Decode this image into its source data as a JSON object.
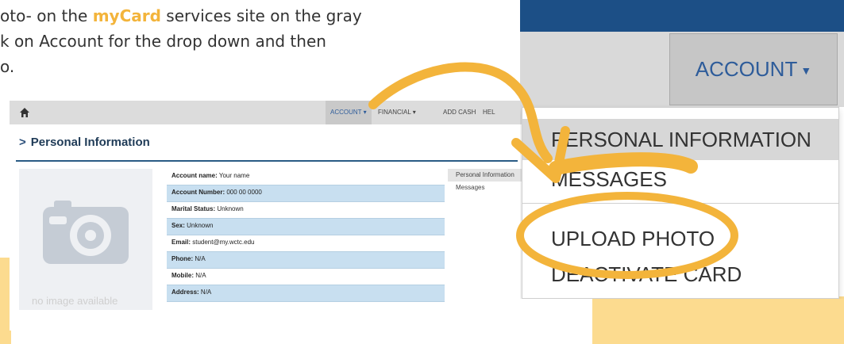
{
  "instructions": {
    "line1_before": "oto- on the ",
    "line1_brand": "myCard",
    "line1_after": " services site on the gray",
    "line2": "k on Account for the drop down and then",
    "line3": "o."
  },
  "portal": {
    "nav": {
      "home_icon": "home-icon",
      "items": [
        "ACCOUNT ▾",
        "FINANCIAL ▾",
        "ADD CASH",
        "HEL"
      ]
    },
    "page_title": "Personal Information",
    "no_image": "no image available",
    "info_rows": [
      {
        "label": "Account name:",
        "value": " Your name"
      },
      {
        "label": "Account Number:",
        "value": " 000 00 0000"
      },
      {
        "label": "Marital Status:",
        "value": " Unknown"
      },
      {
        "label": "Sex:",
        "value": " Unknown"
      },
      {
        "label": "Email:",
        "value": " student@my.wctc.edu"
      },
      {
        "label": "Phone:",
        "value": " N/A"
      },
      {
        "label": "Mobile:",
        "value": " N/A"
      },
      {
        "label": "Address:",
        "value": " N/A"
      }
    ],
    "side_menu": [
      "Personal Information",
      "Messages"
    ]
  },
  "zoom": {
    "account_label": "ACCOUNT",
    "menu": [
      "PERSONAL INFORMATION",
      "MESSAGES",
      "UPLOAD PHOTO",
      "DEACTIVATE CARD"
    ]
  },
  "colors": {
    "brand_yellow": "#f3b43b",
    "nav_blue": "#1c4f86",
    "row_blue": "#c8dff0",
    "deco_yellow": "#fcdb8f"
  }
}
